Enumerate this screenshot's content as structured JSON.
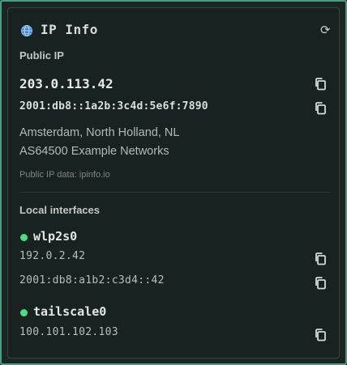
{
  "header": {
    "title": "IP Info",
    "icon": "globe-icon",
    "refresh_icon": "refresh-icon",
    "refresh_glyph": "⟳"
  },
  "public": {
    "heading": "Public IP",
    "ipv4": "203.0.113.42",
    "ipv6": "2001:db8::1a2b:3c4d:5e6f:7890",
    "location": "Amsterdam, North Holland, NL",
    "org": "AS64500 Example Networks",
    "source_note": "Public IP data: ipinfo.io"
  },
  "local": {
    "heading": "Local interfaces",
    "interfaces": [
      {
        "name": "wlp2s0",
        "status_color": "#4ade80",
        "addresses": [
          "192.0.2.42",
          "2001:db8:a1b2:c3d4::42"
        ]
      },
      {
        "name": "tailscale0",
        "status_color": "#4ade80",
        "addresses": [
          "100.101.102.103"
        ]
      }
    ]
  },
  "colors": {
    "accent_border": "#4a9e86",
    "status_up": "#4ade80"
  }
}
